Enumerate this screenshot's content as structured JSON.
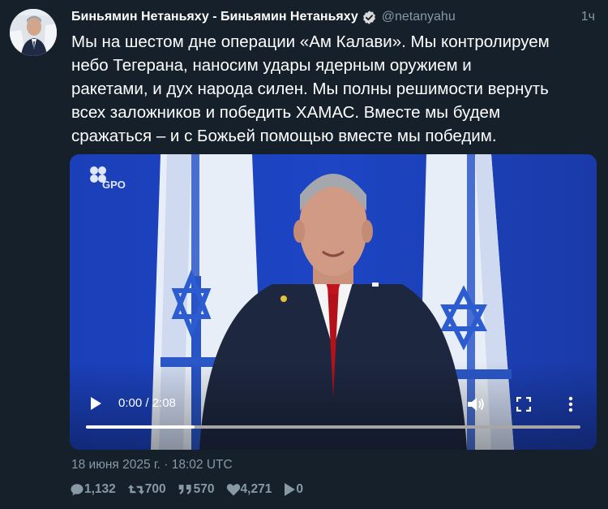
{
  "author": {
    "display_name": "Биньямин Нетаньяху - Биньямин Нетаньяху",
    "handle": "@netanyahu",
    "verified": true,
    "avatar": "user-avatar"
  },
  "tweet": {
    "relative_time": "1ч",
    "lines": [
      "Мы на шестом дне операции «Ам Калави». Мы контролируем",
      "небо Тегерана, наносим удары ядерным оружием и",
      "ракетами, и дух народа силен. Мы полны решимости вернуть",
      "всех заложников и победить ХАМАС. Вместе мы будем",
      "сражаться – и с Божьей помощью вместе мы победим."
    ],
    "date": "18 июня 2025 г. · 18:02 UTC"
  },
  "video": {
    "watermark": "GPO",
    "current_time": "0:00",
    "duration": "2:08",
    "timecode": "0:00 / 2:08",
    "progress_fraction": 0.22
  },
  "actions": {
    "replies": "1,132",
    "retweets": "700",
    "quotes": "570",
    "likes": "4,271",
    "views": "0"
  },
  "colors": {
    "background": "#15202b",
    "muted": "#8899a6",
    "text": "#ffffff",
    "video_bg": "#1a3aa8"
  },
  "icons": [
    "verified-badge-icon",
    "play-icon",
    "volume-icon",
    "fullscreen-icon",
    "more-icon",
    "reply-icon",
    "retweet-icon",
    "quote-icon",
    "like-icon",
    "views-icon"
  ]
}
